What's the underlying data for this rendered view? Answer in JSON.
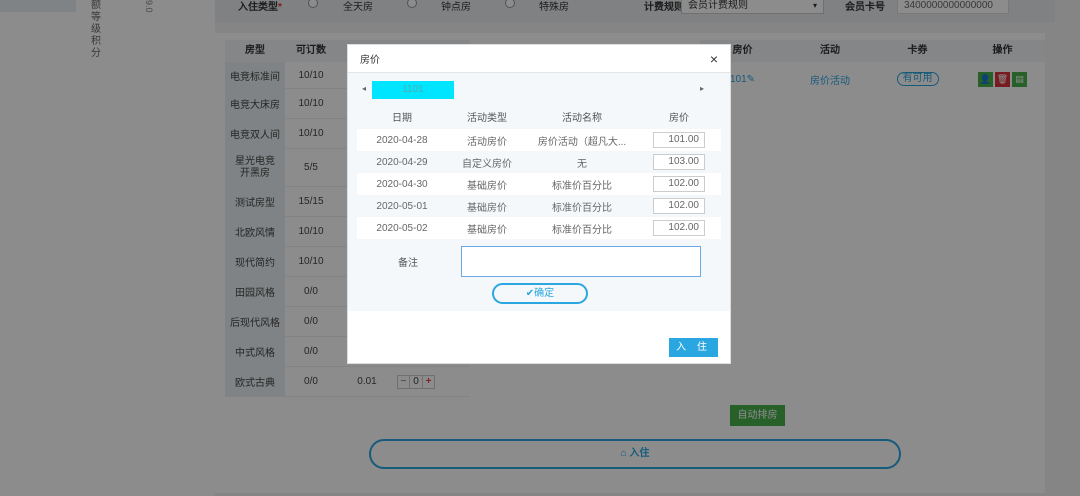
{
  "left": {
    "vertical_text_1": "额等级积分",
    "vertical_text_2": "9.0"
  },
  "filter": {
    "stay_type_label": "入住类型",
    "required_mark": "*",
    "options": [
      "全天房",
      "钟点房",
      "特殊房"
    ],
    "billing_rule_label": "计费规则",
    "billing_rule_value": "会员计费规则",
    "member_card_label": "会员卡号",
    "member_card_value": "3400000000000000"
  },
  "room_table": {
    "headers": [
      "房型",
      "可订数"
    ],
    "rows": [
      {
        "name": "电竞标准间",
        "available": "10/10"
      },
      {
        "name": "电竞大床房",
        "available": "10/10"
      },
      {
        "name": "电竞双人间",
        "available": "10/10"
      },
      {
        "name": "星光电竞开黑房",
        "available": "5/5"
      },
      {
        "name": "测试房型",
        "available": "15/15"
      },
      {
        "name": "北欧风情",
        "available": "10/10"
      },
      {
        "name": "现代简约",
        "available": "10/10"
      },
      {
        "name": "田园风格",
        "available": "0/0"
      },
      {
        "name": "后现代风格",
        "available": "0/0"
      },
      {
        "name": "中式风格",
        "available": "0/0"
      },
      {
        "name": "欧式古典",
        "available": "0/0",
        "price": "0.01",
        "qty": "0"
      }
    ]
  },
  "right_table": {
    "headers": [
      "房价",
      "活动",
      "卡券",
      "操作"
    ],
    "row": {
      "price": "101",
      "activity": "房价活动",
      "coupon": "有可用"
    }
  },
  "auto_assign_label": "自动排房",
  "checkin_label": "入住",
  "modal": {
    "title": "房价",
    "close": "×",
    "tab_prev": "◂",
    "tab_next": "▸",
    "active_tab": "1101",
    "headers": [
      "日期",
      "活动类型",
      "活动名称",
      "房价"
    ],
    "rows": [
      {
        "date": "2020-04-28",
        "type": "活动房价",
        "name": "房价活动（超凡大...",
        "price": "101.00"
      },
      {
        "date": "2020-04-29",
        "type": "自定义房价",
        "name": "无",
        "price": "103.00"
      },
      {
        "date": "2020-04-30",
        "type": "基础房价",
        "name": "标准价百分比",
        "price": "102.00"
      },
      {
        "date": "2020-05-01",
        "type": "基础房价",
        "name": "标准价百分比",
        "price": "102.00"
      },
      {
        "date": "2020-05-02",
        "type": "基础房价",
        "name": "标准价百分比",
        "price": "102.00"
      }
    ],
    "remark_label": "备注",
    "confirm_label": "✔确定",
    "checkin_label": "入 住"
  }
}
